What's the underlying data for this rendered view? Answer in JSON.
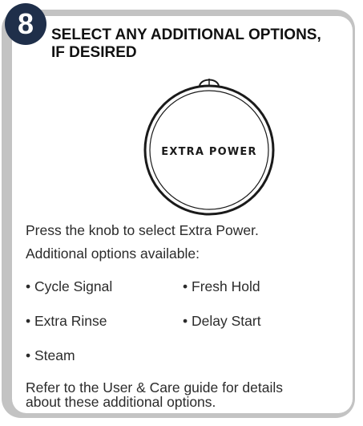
{
  "step": {
    "number": "8",
    "title_line1": "SELECT ANY ADDITIONAL OPTIONS,",
    "title_line2": "IF DESIRED"
  },
  "knob": {
    "label": "EXTRA POWER"
  },
  "instructions": {
    "press": "Press the knob to select Extra Power.",
    "available": "Additional options available:"
  },
  "options": [
    "Cycle Signal",
    "Fresh Hold",
    "Extra Rinse",
    "Delay Start",
    "Steam"
  ],
  "footer": {
    "line1": "Refer to the User & Care guide for details",
    "line2": "about these additional options."
  },
  "colors": {
    "frame": "#c3c3c3",
    "badge": "#1f2f4a",
    "text": "#2b2b2b"
  }
}
